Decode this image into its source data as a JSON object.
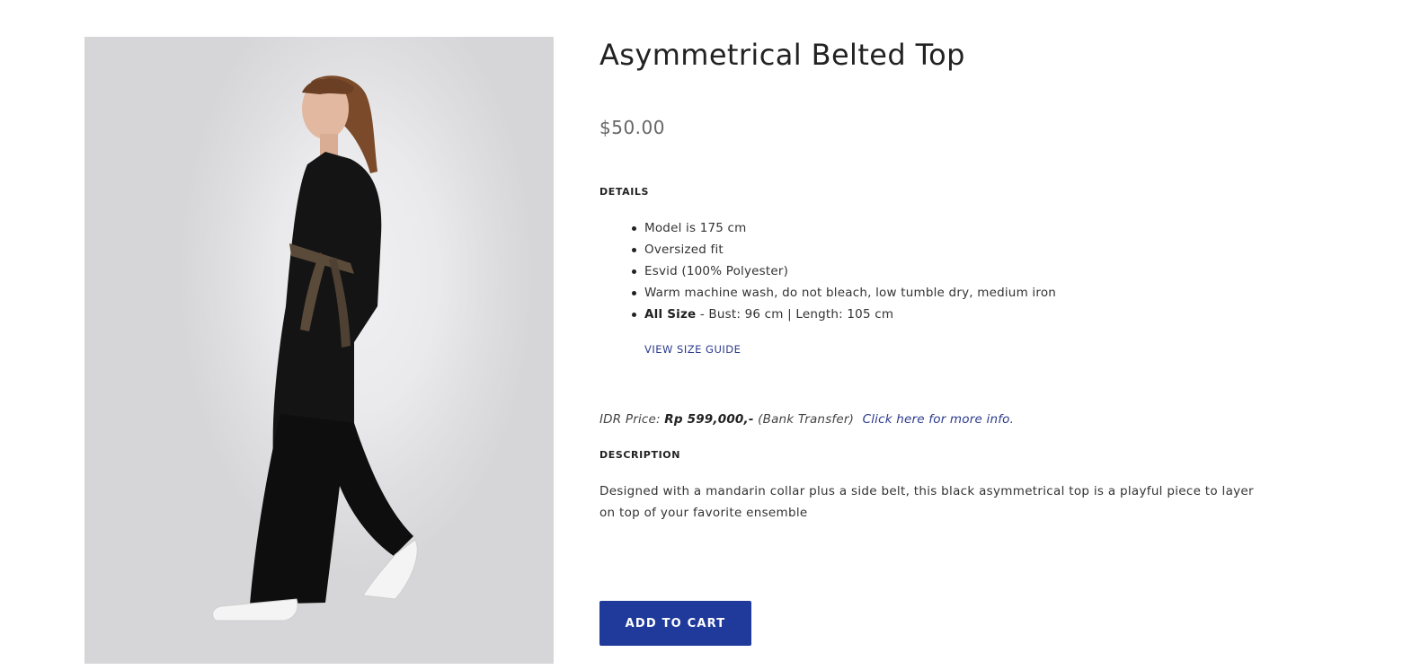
{
  "product": {
    "title": "Asymmetrical Belted Top",
    "price": "$50.00",
    "image_alt": "Model wearing black asymmetrical belted top with brown side belt"
  },
  "details": {
    "heading": "DETAILS",
    "items": [
      {
        "text": "Model is 175 cm"
      },
      {
        "text": "Oversized fit"
      },
      {
        "text": "Esvid (100% Polyester)"
      },
      {
        "text": "Warm machine wash, do not bleach, low tumble dry, medium iron"
      },
      {
        "label": "All Size",
        "text": " - Bust: 96 cm | Length: 105 cm"
      }
    ],
    "size_guide_label": "VIEW SIZE GUIDE"
  },
  "idr": {
    "prefix": "IDR Price: ",
    "amount": "Rp 599,000,-",
    "method": " (Bank Transfer)",
    "link_label": "Click here for more info."
  },
  "description": {
    "heading": "DESCRIPTION",
    "text": "Designed with a mandarin collar plus a side belt, this black asymmetrical top is a playful piece to layer on top of your favorite ensemble"
  },
  "cart": {
    "button_label": "ADD TO CART"
  },
  "colors": {
    "accent": "#1f3a9a",
    "link": "#2b3a8c",
    "garment": "#141414",
    "belt": "#5a4a3a"
  }
}
